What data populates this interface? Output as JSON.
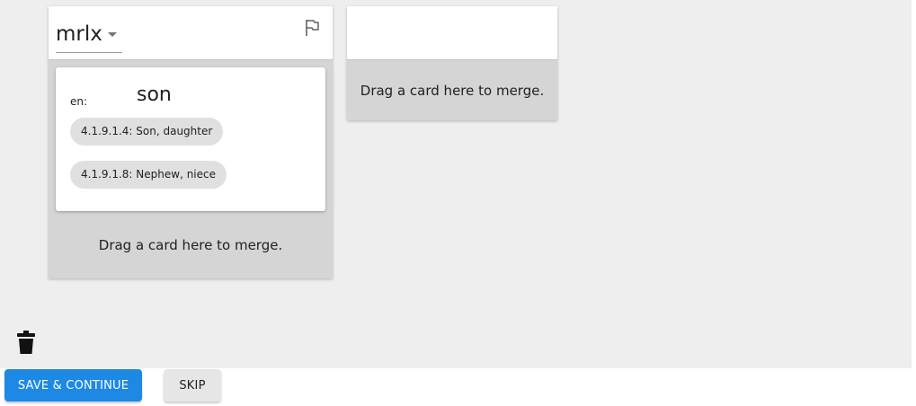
{
  "columns": [
    {
      "vernacular": "mrlx",
      "cards": [
        {
          "language": "en:",
          "gloss": "son",
          "domains": [
            "4.1.9.1.4: Son, daughter",
            "4.1.9.1.8: Nephew, niece"
          ]
        }
      ],
      "drop_hint": "Drag a card here to merge."
    },
    {
      "vernacular": "",
      "drop_hint": "Drag a card here to merge."
    }
  ],
  "buttons": {
    "save_label": "SAVE & CONTINUE",
    "skip_label": "SKIP"
  },
  "icons": {
    "flag": "flag-outline-icon",
    "delete": "trash-icon",
    "dropdown": "caret-down-icon"
  },
  "colors": {
    "primary": "#1e88e5",
    "workspace_bg": "#eeeeee",
    "column_bg": "#d5d5d5",
    "chip_bg": "#e0e0e0"
  }
}
